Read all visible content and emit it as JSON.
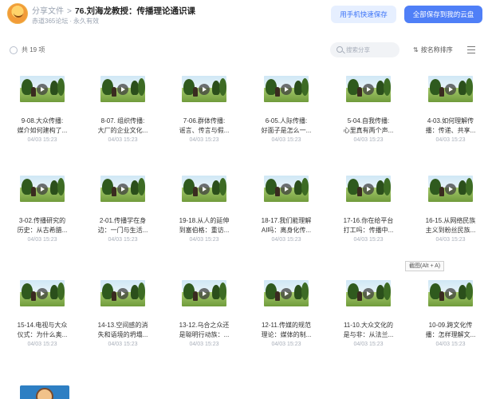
{
  "header": {
    "breadcrumb_root": "分享文件",
    "breadcrumb_sep": ">",
    "title": "76.刘海龙教授：传播理论通识课",
    "source": "赤道365论坛",
    "sub_dot": "·",
    "validity": "永久有效",
    "btn_mobile": "用手机快速保存",
    "btn_save_all": "全部保存到我的云盘"
  },
  "toolbar": {
    "count": "共 19 项",
    "search_placeholder": "搜索分享",
    "sort_label": "按名称排序",
    "sort_icon": "⇅"
  },
  "tooltip": "截图(Alt + A)",
  "files": [
    {
      "name1": "9-08.大众传播:",
      "name2": "媒介如何建构了...",
      "date": "04/03 15:23"
    },
    {
      "name1": "8-07. 组织传播:",
      "name2": "大厂的企业文化...",
      "date": "04/03 15:23"
    },
    {
      "name1": "7-06.群体传播:",
      "name2": "谣言、传言与假...",
      "date": "04/03 15:23"
    },
    {
      "name1": "6-05.人际传播:",
      "name2": "好面子是怎么一...",
      "date": "04/03 15:23"
    },
    {
      "name1": "5-04.自我传播:",
      "name2": "心里真有两个声...",
      "date": "04/03 15:23"
    },
    {
      "name1": "4-03.如何理解传",
      "name2": "播：传递、共享...",
      "date": "04/03 15:23"
    },
    {
      "name1": "3-02.传播研究的",
      "name2": "历史：从古希腊...",
      "date": "04/03 15:23"
    },
    {
      "name1": "2-01.传播学在身",
      "name2": "边：一门与生活...",
      "date": "04/03 15:23"
    },
    {
      "name1": "19-18.从人的延伸",
      "name2": "到塞伯格：重访...",
      "date": "04/03 15:23"
    },
    {
      "name1": "18-17.我们能理解",
      "name2": "AI吗：离身化传...",
      "date": "04/03 15:23"
    },
    {
      "name1": "17-16.你在给平台",
      "name2": "打工吗：传播中...",
      "date": "04/03 15:23"
    },
    {
      "name1": "16-15.从网络民族",
      "name2": "主义到粉丝民族...",
      "date": "04/03 15:23"
    },
    {
      "name1": "15-14.电视与大众",
      "name2": "仪式：为什么奥...",
      "date": "04/03 15:23"
    },
    {
      "name1": "14-13.空间感的消",
      "name2": "失和语境的坍塌...",
      "date": "04/03 15:23"
    },
    {
      "name1": "13-12.乌合之众还",
      "name2": "是聪明行动族：...",
      "date": "04/03 15:23"
    },
    {
      "name1": "12-11.传媒的规范",
      "name2": "理论：媒体的制...",
      "date": "04/03 15:23"
    },
    {
      "name1": "11-10.大众文化的",
      "name2": "是与非：从法兰...",
      "date": "04/03 15:23"
    },
    {
      "name1": "10-09.跨文化传",
      "name2": "播：怎样理解文...",
      "date": "04/03 15:23"
    }
  ]
}
